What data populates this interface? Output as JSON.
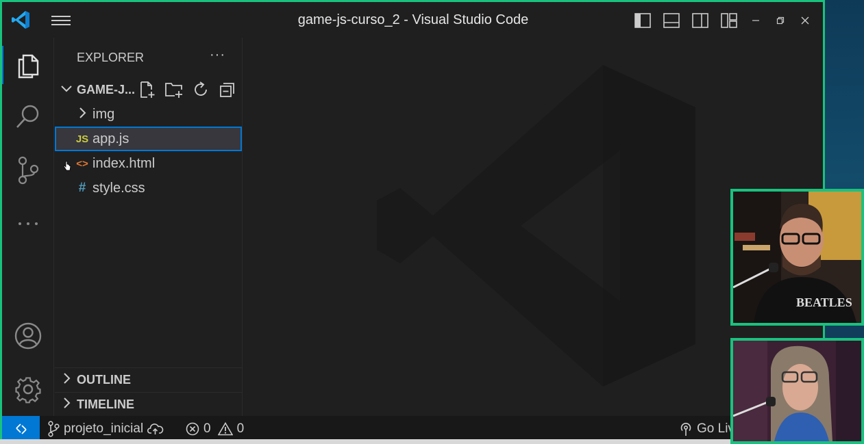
{
  "window": {
    "title": "game-js-curso_2 - Visual Studio Code"
  },
  "sidebar": {
    "header": "EXPLORER",
    "more": "···",
    "folder": "GAME-J...",
    "items": [
      {
        "label": "img",
        "icon": "chevron-right-icon",
        "icon_text": ">"
      },
      {
        "label": "app.js",
        "icon": "javascript-file-icon",
        "icon_text": "JS",
        "selected": true
      },
      {
        "label": "index.html",
        "icon": "html-file-icon",
        "icon_text": "<>"
      },
      {
        "label": "style.css",
        "icon": "css-file-icon",
        "icon_text": "#"
      }
    ],
    "outline": "OUTLINE",
    "timeline": "TIMELINE"
  },
  "statusbar": {
    "branch": "projeto_inicial",
    "errors": "0",
    "warnings": "0",
    "golive": "Go Live"
  },
  "colors": {
    "accent": "#0078d4",
    "border_green": "#19c27e",
    "js": "#cbcb41",
    "html": "#e37933",
    "css": "#519aba"
  }
}
